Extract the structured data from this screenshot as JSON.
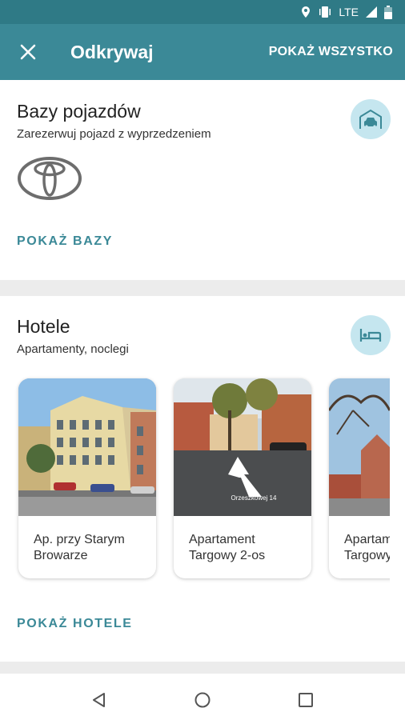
{
  "statusbar": {
    "network": "LTE"
  },
  "appbar": {
    "title": "Odkrywaj",
    "show_all": "POKAŻ WSZYSTKO"
  },
  "vehicles": {
    "title": "Bazy pojazdów",
    "subtitle": "Zarezerwuj pojazd z wyprzedzeniem",
    "logo": "toyota-logo",
    "link": "POKAŻ BAZY"
  },
  "hotels": {
    "title": "Hotele",
    "subtitle": "Apartamenty, noclegi",
    "link": "POKAŻ HOTELE",
    "items": [
      {
        "name": "Ap. przy Starym Browarze"
      },
      {
        "name": "Apartament Targowy 2-os",
        "photo_caption": "Orzeszkowej 14"
      },
      {
        "name": "Apartament Targowy"
      }
    ]
  },
  "colors": {
    "primary": "#3b8997",
    "status": "#2f7a86",
    "icon_bg": "#c5e6ef"
  }
}
